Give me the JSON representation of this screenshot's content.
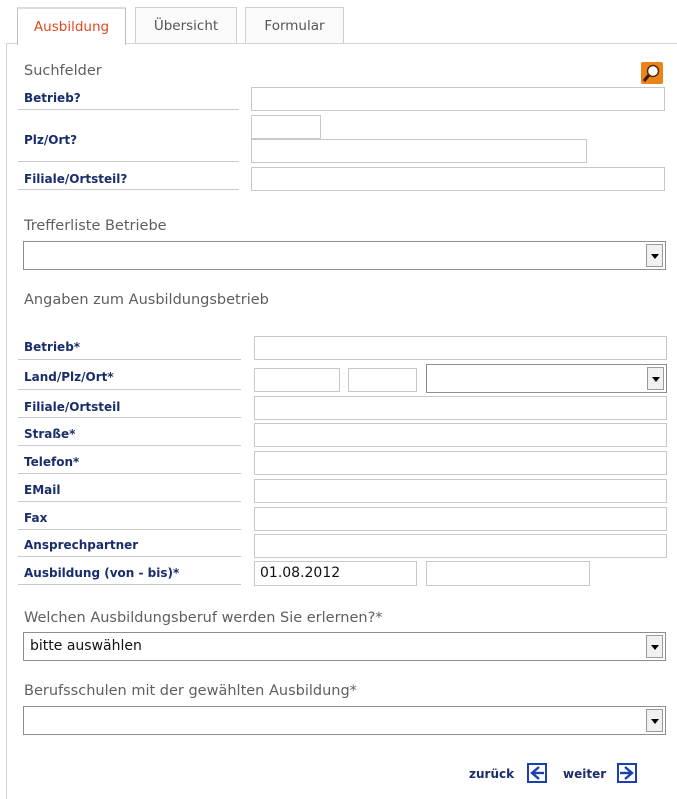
{
  "tabs": [
    "Ausbildung",
    "Übersicht",
    "Formular"
  ],
  "search": {
    "heading": "Suchfelder",
    "fields": [
      "Betrieb?",
      "Plz/Ort?",
      "Filiale/Ortsteil?"
    ]
  },
  "results": {
    "heading": "Trefferliste Betriebe",
    "selected": ""
  },
  "company": {
    "heading": "Angaben zum Ausbildungsbetrieb",
    "labels": [
      "Betrieb*",
      "Land/Plz/Ort*",
      "Filiale/Ortsteil",
      "Straße*",
      "Telefon*",
      "EMail",
      "Fax",
      "Ansprechpartner",
      "Ausbildung (von - bis)*"
    ],
    "date_from": "01.08.2012",
    "date_to": ""
  },
  "profession": {
    "heading": "Welchen Ausbildungsberuf werden Sie erlernen?*",
    "selected": "bitte auswählen"
  },
  "schools": {
    "heading": "Berufsschulen mit der gewählten Ausbildung*",
    "selected": ""
  },
  "nav": {
    "back": "zurück",
    "next": "weiter"
  },
  "colors": {
    "active_tab": "#e04822",
    "label": "#1a2d6b",
    "nav_icon": "#1a3fb0",
    "search_icon": "#e8841a"
  },
  "icons": {
    "search": "magnifier-icon",
    "back": "arrow-left-icon",
    "next": "arrow-right-icon"
  }
}
